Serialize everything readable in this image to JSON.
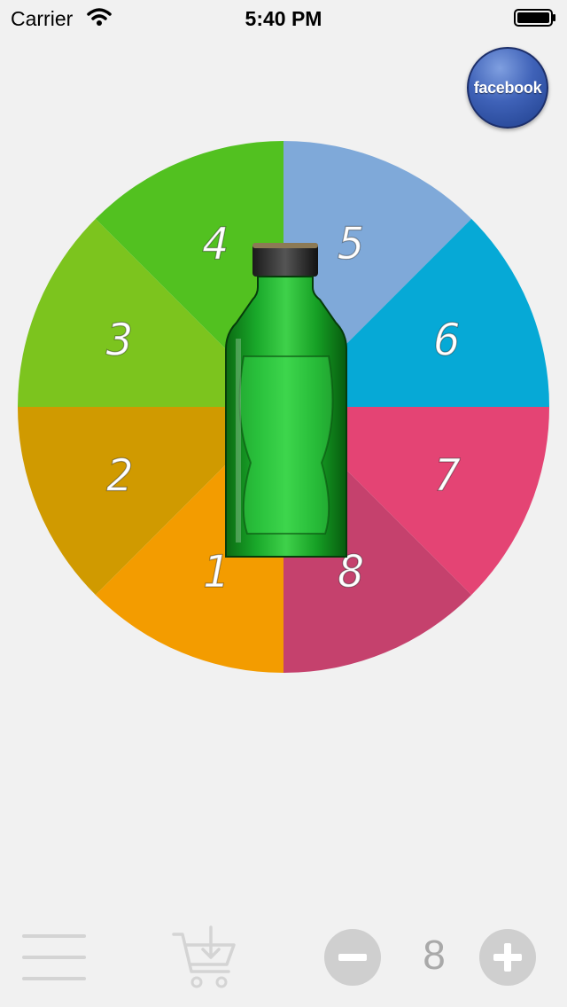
{
  "status_bar": {
    "carrier": "Carrier",
    "time": "5:40 PM"
  },
  "facebook_button": {
    "label": "facebook"
  },
  "wheel": {
    "segments": [
      {
        "label": "1",
        "color": "#f39c00"
      },
      {
        "label": "2",
        "color": "#d09a00"
      },
      {
        "label": "3",
        "color": "#7cc41e"
      },
      {
        "label": "4",
        "color": "#52c120"
      },
      {
        "label": "5",
        "color": "#7fa9d9"
      },
      {
        "label": "6",
        "color": "#06a9d6"
      },
      {
        "label": "7",
        "color": "#e44474"
      },
      {
        "label": "8",
        "color": "#c5416d"
      }
    ],
    "center_object": "green-bottle"
  },
  "bottom_bar": {
    "menu_icon": "hamburger-menu-icon",
    "cart_icon": "cart-download-icon",
    "player_count": "8"
  }
}
